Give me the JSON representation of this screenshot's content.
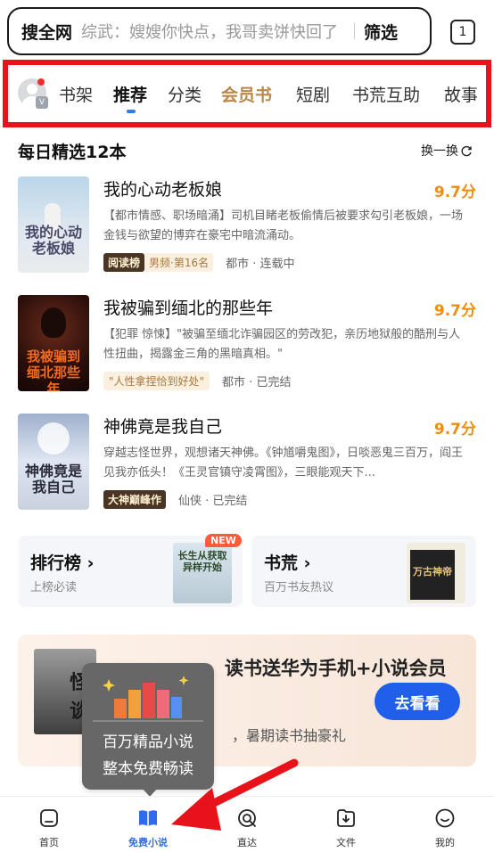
{
  "search": {
    "scope": "搜全网",
    "query": "综武：嫂嫂你快点，我哥卖饼快回了",
    "filter": "筛选",
    "tab_count": "1"
  },
  "nav": {
    "items": [
      "书架",
      "推荐",
      "分类",
      "会员书",
      "短剧",
      "书荒互助",
      "故事"
    ],
    "active": "推荐",
    "avatar_badge": "V"
  },
  "section": {
    "title": "每日精选12本",
    "refresh": "换一换"
  },
  "books": [
    {
      "title": "我的心动老板娘",
      "score": "9.7分",
      "desc": "【都市情感、职场暗涌】司机目睹老板偷情后被要求勾引老板娘，一场金钱与欲望的博弈在豪宅中暗流涌动。",
      "tag1": "阅读榜",
      "tag2": "男频·第16名",
      "meta": "都市 · 连载中",
      "cover_text": "我的心动老板娘",
      "cover_colors": [
        "#b9d6ea",
        "#e7eef3"
      ],
      "cover_text_color": "#4a4a6a"
    },
    {
      "title": "我被骗到缅北的那些年",
      "score": "9.7分",
      "desc": "【犯罪 惊悚】\"被骗至缅北诈骗园区的劳改犯，亲历地狱般的酷刑与人性扭曲，揭露金三角的黑暗真相。\"",
      "tag1": "\"人性拿捏恰到好处\"",
      "tag2": "",
      "meta": "都市 · 已完结",
      "cover_text": "我被骗到缅北那些年",
      "cover_colors": [
        "#3a1410",
        "#1d0b08"
      ],
      "cover_text_color": "#f26a1e"
    },
    {
      "title": "神佛竟是我自己",
      "score": "9.7分",
      "desc": "穿越志怪世界，观想诸天神佛。《钟馗嚼鬼图》，日啖恶鬼三百万，阎王见我亦低头！《王灵官镇守凌霄图》，三眼能观天下...",
      "tag1": "大神巅峰作",
      "tag2": "",
      "meta": "仙侠 · 已完结",
      "cover_text": "神佛竟是我自己",
      "cover_colors": [
        "#aeb8cf",
        "#e7ecf6"
      ],
      "cover_text_color": "#2a2a3a"
    }
  ],
  "cards": [
    {
      "title": "排行榜",
      "subtitle": "上榜必读",
      "badge": "NEW",
      "cover_text": "长生从获取异样开始"
    },
    {
      "title": "书荒",
      "subtitle": "百万书友热议",
      "badge": "",
      "cover_text": "万古神帝"
    }
  ],
  "banner": {
    "title": "读书送华为手机+小说会员",
    "subtitle": "，暑期读书抽豪礼",
    "button": "去看看",
    "cover_text": "怪谈"
  },
  "tooltip": {
    "line1": "百万精品小说",
    "line2": "整本免费畅读"
  },
  "bottom_nav": [
    {
      "label": "首页",
      "icon": "home-icon",
      "active": false
    },
    {
      "label": "免费小说",
      "icon": "book-icon",
      "active": true
    },
    {
      "label": "直达",
      "icon": "direct-search-icon",
      "active": false
    },
    {
      "label": "文件",
      "icon": "file-download-icon",
      "active": false
    },
    {
      "label": "我的",
      "icon": "profile-icon",
      "active": false
    }
  ],
  "colors": {
    "accent_blue": "#2f6bf0",
    "score_orange": "#f08c10",
    "highlight_red": "#e8121a",
    "vip_gold": "#b8884a"
  }
}
